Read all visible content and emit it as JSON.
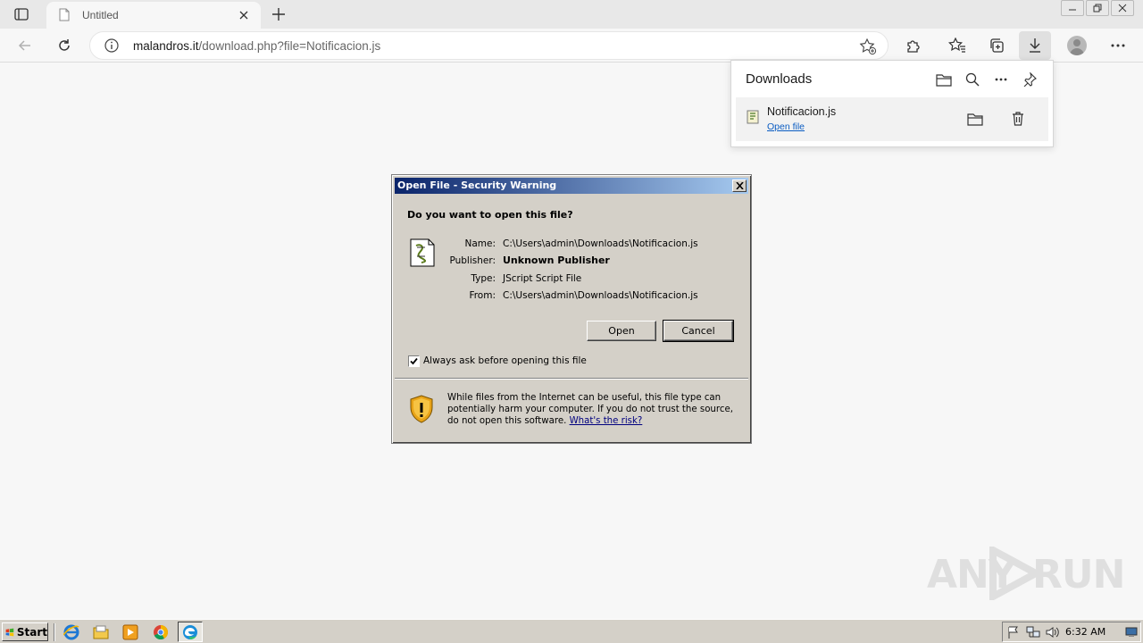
{
  "browser": {
    "tab_title": "Untitled",
    "address": {
      "host": "malandros.it",
      "path": "/download.php?file=Notificacion.js"
    }
  },
  "downloads": {
    "title": "Downloads",
    "item": {
      "filename": "Notificacion.js",
      "open_link": "Open file"
    }
  },
  "dialog": {
    "title": "Open File - Security Warning",
    "question": "Do you want to open this file?",
    "fields": [
      {
        "label": "Name:",
        "value": "C:\\Users\\admin\\Downloads\\Notificacion.js"
      },
      {
        "label": "Publisher:",
        "value": "Unknown Publisher"
      },
      {
        "label": "Type:",
        "value": "JScript Script File"
      },
      {
        "label": "From:",
        "value": "C:\\Users\\admin\\Downloads\\Notificacion.js"
      }
    ],
    "open_label": "Open",
    "cancel_label": "Cancel",
    "checkbox_label": "Always ask before opening this file",
    "checkbox_checked": true,
    "warning_text": "While files from the Internet can be useful, this file type can potentially harm your computer. If you do not trust the source, do not open this software. ",
    "risk_link": "What's the risk?"
  },
  "watermark": {
    "left": "ANY",
    "right": "RUN"
  },
  "taskbar": {
    "start_label": "Start",
    "clock": "6:32 AM"
  },
  "colors": {
    "dialog_bg": "#d4d0c8",
    "titlebar_start": "#0a246a",
    "titlebar_end": "#a6caf0",
    "link": "#0a5cc2"
  }
}
